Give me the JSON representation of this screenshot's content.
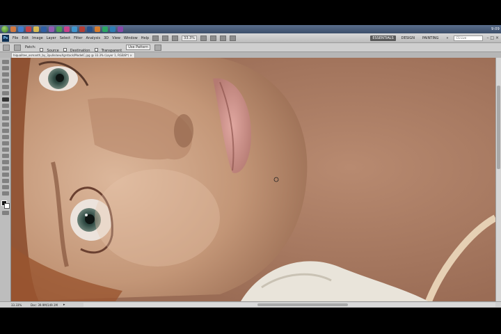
{
  "taskbar": {
    "tray_time": "9:09"
  },
  "appbar": {
    "logo": "Ps",
    "menus": [
      "File",
      "Edit",
      "Image",
      "Layer",
      "Select",
      "Filter",
      "Analysis",
      "3D",
      "View",
      "Window",
      "Help"
    ],
    "zoom": "33.3%",
    "workspaces": [
      "ESSENTIALS",
      "DESIGN",
      "PAINTING"
    ],
    "more": "»",
    "search_placeholder": "CS Live",
    "window_controls": "– □ ×"
  },
  "optbar": {
    "tool": "patch-tool",
    "patch_label": "Patch:",
    "source_label": "Source",
    "destination_label": "Destination",
    "transparent_label": "Transparent",
    "use_pattern_label": "Use Pattern"
  },
  "document": {
    "tab_title": "hiqualitee_osmanth_by_3pulle/aeuXgrstock/ModelC.jpg @ 33.3% (Layer 1, RGB/8*) ×"
  },
  "statusbar": {
    "zoom": "33.33%",
    "doc_info": "Doc: 39.9M/149.1M",
    "arrow": "▸"
  },
  "colors": {
    "accent_workspace": "#5a5a5a",
    "canvas_skin": "#b58a6e",
    "foreground_swatch": "#111111",
    "background_swatch": "#ffffff"
  }
}
